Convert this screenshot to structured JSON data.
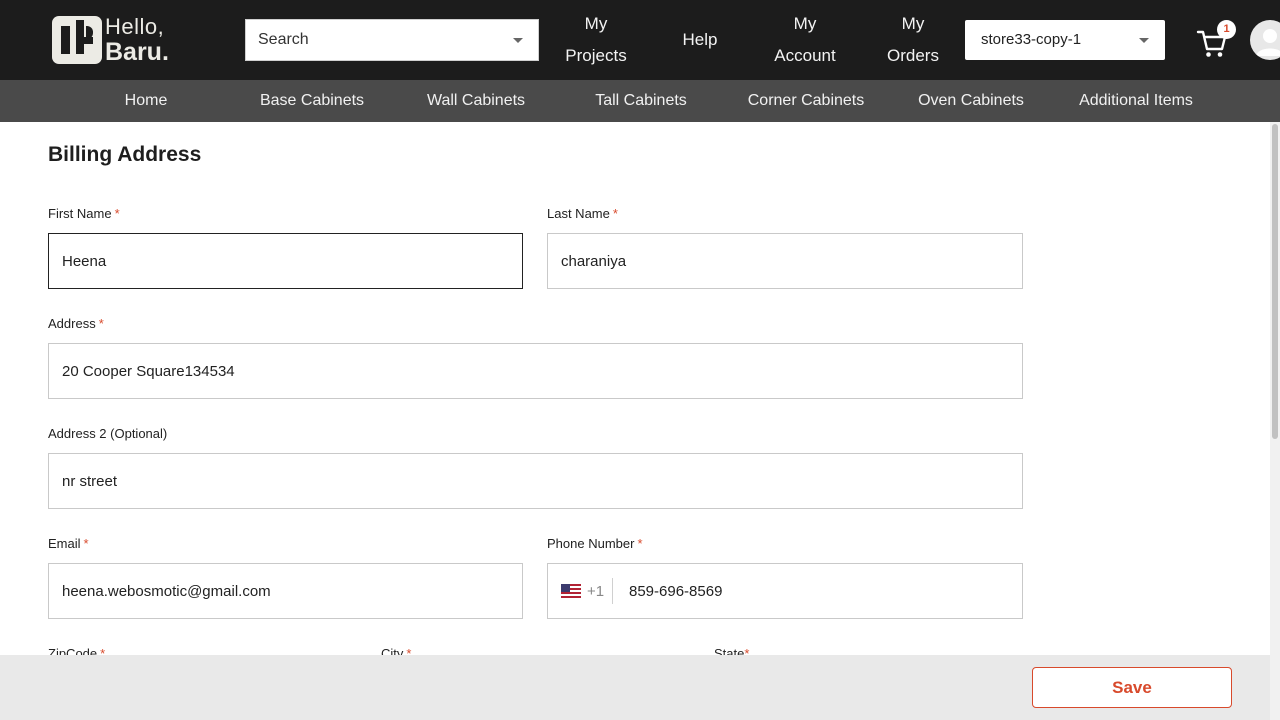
{
  "brand": {
    "hello": "Hello,",
    "baru": "Baru."
  },
  "header": {
    "search_placeholder": "Search",
    "nav": {
      "my_projects": [
        "My",
        "Projects"
      ],
      "help": "Help",
      "my_account": [
        "My",
        "Account"
      ],
      "my_orders": [
        "My",
        "Orders"
      ]
    },
    "store_selected": "store33-copy-1",
    "cart_count": "1",
    "icons": {
      "cart": "shopping-cart-icon",
      "avatar": "user-avatar-icon",
      "dropdown": "chevron-down-icon"
    }
  },
  "categories": [
    "Home",
    "Base Cabinets",
    "Wall Cabinets",
    "Tall Cabinets",
    "Corner Cabinets",
    "Oven Cabinets",
    "Additional Items"
  ],
  "form": {
    "title": "Billing Address",
    "first_name": {
      "label": "First Name",
      "value": "Heena"
    },
    "last_name": {
      "label": "Last Name",
      "value": "charaniya"
    },
    "address": {
      "label": "Address",
      "value": "20 Cooper Square134534"
    },
    "address2": {
      "label": "Address 2 (Optional)",
      "value": "nr street"
    },
    "email": {
      "label": "Email",
      "value": "heena.webosmotic@gmail.com"
    },
    "phone": {
      "label": "Phone Number",
      "dial_code": "+1",
      "value": "859-696-8569"
    },
    "zipcode": {
      "label": "ZipCode"
    },
    "city": {
      "label": "City"
    },
    "state": {
      "label": "State"
    },
    "required_mark": "*"
  },
  "footer": {
    "save_label": "Save"
  },
  "colors": {
    "accent": "#d84a2c",
    "header_bg": "#1c1c1c",
    "category_bg": "#4a4a4a"
  }
}
